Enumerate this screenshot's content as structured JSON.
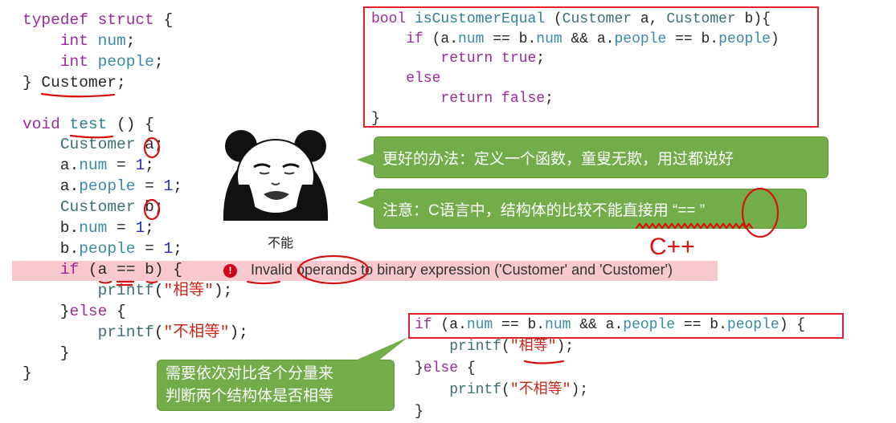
{
  "main_code": [
    [
      [
        "typedef",
        "kw"
      ],
      [
        " ",
        "pl"
      ],
      [
        "struct",
        "kw"
      ],
      [
        " {",
        "pl"
      ]
    ],
    [
      [
        "    ",
        "pl"
      ],
      [
        "int",
        "kw"
      ],
      [
        " ",
        "pl"
      ],
      [
        "num",
        "mb"
      ],
      [
        ";",
        "pl"
      ]
    ],
    [
      [
        "    ",
        "pl"
      ],
      [
        "int",
        "kw"
      ],
      [
        " ",
        "pl"
      ],
      [
        "people",
        "mb"
      ],
      [
        ";",
        "pl"
      ]
    ],
    [
      [
        "} Customer;",
        "pl"
      ]
    ],
    [
      [
        "",
        "pl"
      ]
    ],
    [
      [
        "void",
        "kw"
      ],
      [
        " ",
        "pl"
      ],
      [
        "test",
        "fn"
      ],
      [
        " () {",
        "pl"
      ]
    ],
    [
      [
        "    ",
        "pl"
      ],
      [
        "Customer",
        "ty"
      ],
      [
        " a;",
        "pl"
      ]
    ],
    [
      [
        "    a.",
        "pl"
      ],
      [
        "num",
        "mb"
      ],
      [
        " = ",
        "pl"
      ],
      [
        "1",
        "nu"
      ],
      [
        ";",
        "pl"
      ]
    ],
    [
      [
        "    a.",
        "pl"
      ],
      [
        "people",
        "mb"
      ],
      [
        " = ",
        "pl"
      ],
      [
        "1",
        "nu"
      ],
      [
        ";",
        "pl"
      ]
    ],
    [
      [
        "    ",
        "pl"
      ],
      [
        "Customer",
        "ty"
      ],
      [
        " b;",
        "pl"
      ]
    ],
    [
      [
        "    b.",
        "pl"
      ],
      [
        "num",
        "mb"
      ],
      [
        " = ",
        "pl"
      ],
      [
        "1",
        "nu"
      ],
      [
        ";",
        "pl"
      ]
    ],
    [
      [
        "    b.",
        "pl"
      ],
      [
        "people",
        "mb"
      ],
      [
        " = ",
        "pl"
      ],
      [
        "1",
        "nu"
      ],
      [
        ";",
        "pl"
      ]
    ],
    [
      [
        "    ",
        "pl"
      ],
      [
        "if",
        "kw"
      ],
      [
        " (a == b) {",
        "pl"
      ]
    ],
    [
      [
        "        ",
        "pl"
      ],
      [
        "printf",
        "ty"
      ],
      [
        "(",
        "pl"
      ],
      [
        "\"相等\"",
        "st"
      ],
      [
        ");",
        "pl"
      ]
    ],
    [
      [
        "    }",
        "pl"
      ],
      [
        "else",
        "kw"
      ],
      [
        " {",
        "pl"
      ]
    ],
    [
      [
        "        ",
        "pl"
      ],
      [
        "printf",
        "ty"
      ],
      [
        "(",
        "pl"
      ],
      [
        "\"不相等\"",
        "st"
      ],
      [
        ");",
        "pl"
      ]
    ],
    [
      [
        "    }",
        "pl"
      ]
    ],
    [
      [
        "}",
        "pl"
      ]
    ]
  ],
  "function_code": [
    [
      [
        "bool",
        "kw"
      ],
      [
        " ",
        "pl"
      ],
      [
        "isCustomerEqual",
        "fn"
      ],
      [
        " (",
        "pl"
      ],
      [
        "Customer",
        "ty"
      ],
      [
        " a, ",
        "pl"
      ],
      [
        "Customer",
        "ty"
      ],
      [
        " b){",
        "pl"
      ]
    ],
    [
      [
        "    ",
        "pl"
      ],
      [
        "if",
        "kw"
      ],
      [
        " (a.",
        "pl"
      ],
      [
        "num",
        "mb"
      ],
      [
        " == b.",
        "pl"
      ],
      [
        "num",
        "mb"
      ],
      [
        " && a.",
        "pl"
      ],
      [
        "people",
        "mb"
      ],
      [
        " == b.",
        "pl"
      ],
      [
        "people",
        "mb"
      ],
      [
        ")",
        "pl"
      ]
    ],
    [
      [
        "        ",
        "pl"
      ],
      [
        "return",
        "kw"
      ],
      [
        " ",
        "pl"
      ],
      [
        "true",
        "kw"
      ],
      [
        ";",
        "pl"
      ]
    ],
    [
      [
        "    ",
        "pl"
      ],
      [
        "else",
        "kw"
      ]
    ],
    [
      [
        "        ",
        "pl"
      ],
      [
        "return",
        "kw"
      ],
      [
        " ",
        "pl"
      ],
      [
        "false",
        "kw"
      ],
      [
        ";",
        "pl"
      ]
    ],
    [
      [
        "}",
        "pl"
      ]
    ]
  ],
  "compare_code": [
    [
      [
        "if",
        "kw"
      ],
      [
        " (a.",
        "pl"
      ],
      [
        "num",
        "mb"
      ],
      [
        " == b.",
        "pl"
      ],
      [
        "num",
        "mb"
      ],
      [
        " && a.",
        "pl"
      ],
      [
        "people",
        "mb"
      ],
      [
        " == b.",
        "pl"
      ],
      [
        "people",
        "mb"
      ],
      [
        ") {",
        "pl"
      ]
    ],
    [
      [
        "    ",
        "pl"
      ],
      [
        "printf",
        "ty"
      ],
      [
        "(",
        "pl"
      ],
      [
        "\"相等\"",
        "st"
      ],
      [
        ");",
        "pl"
      ]
    ],
    [
      [
        "}",
        "pl"
      ],
      [
        "else",
        "kw"
      ],
      [
        " {",
        "pl"
      ]
    ],
    [
      [
        "    ",
        "pl"
      ],
      [
        "printf",
        "ty"
      ],
      [
        "(",
        "pl"
      ],
      [
        "\"不相等\"",
        "st"
      ],
      [
        ");",
        "pl"
      ]
    ],
    [
      [
        "}",
        "pl"
      ]
    ]
  ],
  "error": {
    "icon": "error-icon",
    "glyph": "!",
    "message": "Invalid operands to binary expression ('Customer' and 'Customer')"
  },
  "bubbles": {
    "better_way": "更好的办法：定义一个函数，童叟无欺，用过都说好",
    "note": "注意：C语言中，结构体的比较不能直接用 “== ”",
    "compare_each": "需要依次对比各个分量来\n判断两个结构体是否相等"
  },
  "meme": {
    "icon": "panda-meme-icon",
    "caption": "不能"
  },
  "annotation": {
    "handwritten": "C++"
  },
  "colors": {
    "bubble_green": "#72ad4a",
    "highlight_red": "#e0202a",
    "error_pink": "#f7c9cf"
  }
}
